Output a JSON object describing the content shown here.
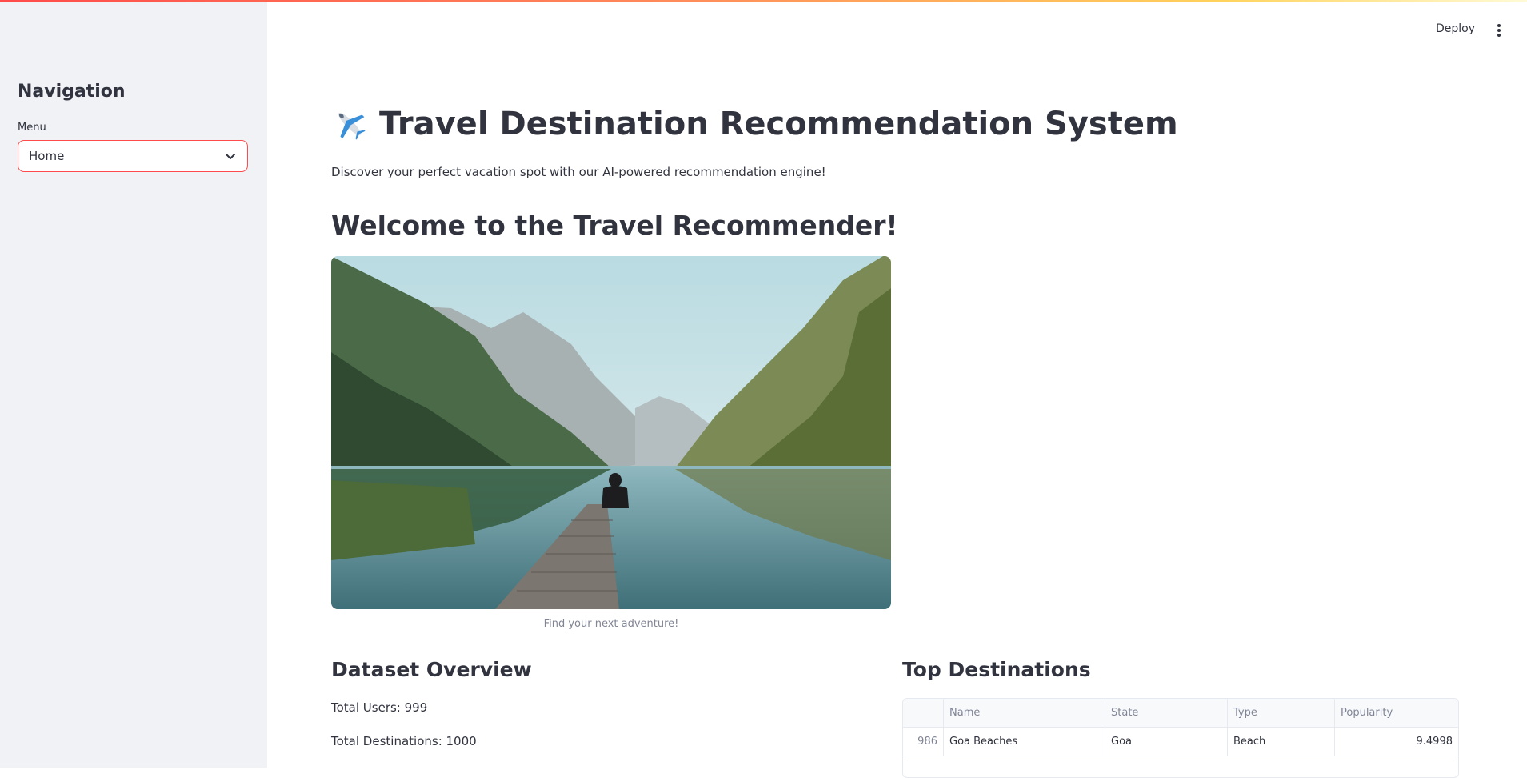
{
  "sidebar": {
    "title": "Navigation",
    "menu_label": "Menu",
    "selected": "Home"
  },
  "header": {
    "deploy_label": "Deploy"
  },
  "main": {
    "title": "Travel Destination Recommendation System",
    "subtitle": "Discover your perfect vacation spot with our AI-powered recommendation engine!",
    "welcome": "Welcome to the Travel Recommender!",
    "image_caption": "Find your next adventure!",
    "overview_title": "Dataset Overview",
    "total_users": "Total Users: 999",
    "total_destinations": "Total Destinations: 1000",
    "top_title": "Top Destinations"
  },
  "table": {
    "columns": [
      "",
      "Name",
      "State",
      "Type",
      "Popularity"
    ],
    "rows": [
      [
        "986",
        "Goa Beaches",
        "Goa",
        "Beach",
        "9.4998"
      ]
    ]
  },
  "colors": {
    "accent": "#ff4b4b",
    "sidebar_bg": "#f0f2f6",
    "text": "#31333f"
  },
  "icons": {
    "title_icon": "airplane-icon",
    "select_icon": "chevron-down-icon",
    "menu_icon": "kebab-menu-icon"
  }
}
